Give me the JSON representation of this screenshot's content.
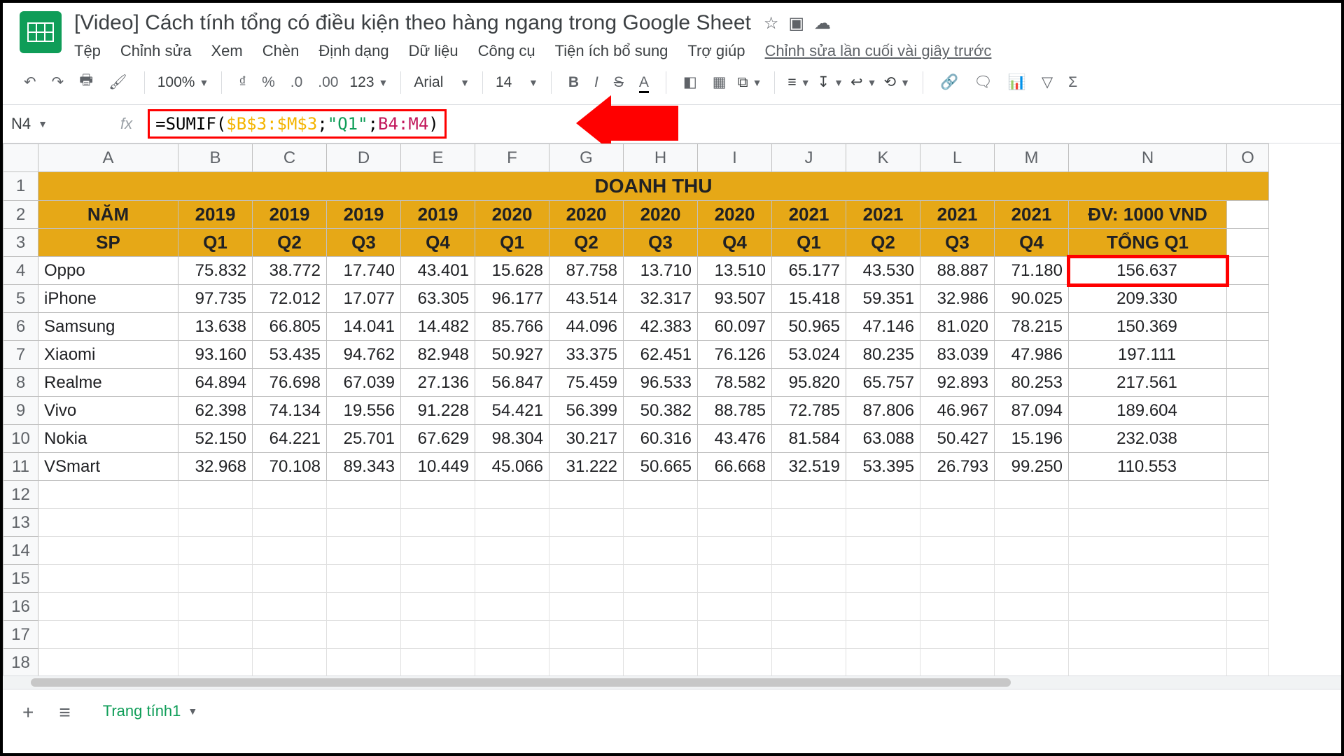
{
  "doc": {
    "title": "[Video] Cách tính tổng có điều kiện theo hàng ngang trong Google Sheet",
    "last_edit": "Chỉnh sửa lần cuối vài giây trước"
  },
  "menu": {
    "file": "Tệp",
    "edit": "Chỉnh sửa",
    "view": "Xem",
    "insert": "Chèn",
    "format": "Định dạng",
    "data": "Dữ liệu",
    "tools": "Công cụ",
    "addons": "Tiện ích bổ sung",
    "help": "Trợ giúp"
  },
  "toolbar": {
    "zoom": "100%",
    "currency": "₫",
    "percent": "%",
    "dec_dec": ".0",
    "dec_inc": ".00",
    "numfmt": "123",
    "font": "Arial",
    "fontsize": "14"
  },
  "namebox": "N4",
  "formula": {
    "func": "=SUMIF(",
    "r1": "$B$3:$M$3",
    "sep1": ";",
    "str": "\"Q1\"",
    "sep2": ";",
    "r2": "B4:M4",
    "close": ")"
  },
  "chart_data": {
    "type": "table",
    "title": "DOANH THU",
    "unit": "ĐV: 1000 VND",
    "col_year": "NĂM",
    "col_sp": "SP",
    "total_label": "TỔNG Q1",
    "years": [
      "2019",
      "2019",
      "2019",
      "2019",
      "2020",
      "2020",
      "2020",
      "2020",
      "2021",
      "2021",
      "2021",
      "2021"
    ],
    "quarters": [
      "Q1",
      "Q2",
      "Q3",
      "Q4",
      "Q1",
      "Q2",
      "Q3",
      "Q4",
      "Q1",
      "Q2",
      "Q3",
      "Q4"
    ],
    "rows": [
      {
        "sp": "Oppo",
        "v": [
          "75.832",
          "38.772",
          "17.740",
          "43.401",
          "15.628",
          "87.758",
          "13.710",
          "13.510",
          "65.177",
          "43.530",
          "88.887",
          "71.180"
        ],
        "total": "156.637"
      },
      {
        "sp": "iPhone",
        "v": [
          "97.735",
          "72.012",
          "17.077",
          "63.305",
          "96.177",
          "43.514",
          "32.317",
          "93.507",
          "15.418",
          "59.351",
          "32.986",
          "90.025"
        ],
        "total": "209.330"
      },
      {
        "sp": "Samsung",
        "v": [
          "13.638",
          "66.805",
          "14.041",
          "14.482",
          "85.766",
          "44.096",
          "42.383",
          "60.097",
          "50.965",
          "47.146",
          "81.020",
          "78.215"
        ],
        "total": "150.369"
      },
      {
        "sp": "Xiaomi",
        "v": [
          "93.160",
          "53.435",
          "94.762",
          "82.948",
          "50.927",
          "33.375",
          "62.451",
          "76.126",
          "53.024",
          "80.235",
          "83.039",
          "47.986"
        ],
        "total": "197.111"
      },
      {
        "sp": "Realme",
        "v": [
          "64.894",
          "76.698",
          "67.039",
          "27.136",
          "56.847",
          "75.459",
          "96.533",
          "78.582",
          "95.820",
          "65.757",
          "92.893",
          "80.253"
        ],
        "total": "217.561"
      },
      {
        "sp": "Vivo",
        "v": [
          "62.398",
          "74.134",
          "19.556",
          "91.228",
          "54.421",
          "56.399",
          "50.382",
          "88.785",
          "72.785",
          "87.806",
          "46.967",
          "87.094"
        ],
        "total": "189.604"
      },
      {
        "sp": "Nokia",
        "v": [
          "52.150",
          "64.221",
          "25.701",
          "67.629",
          "98.304",
          "30.217",
          "60.316",
          "43.476",
          "81.584",
          "63.088",
          "50.427",
          "15.196"
        ],
        "total": "232.038"
      },
      {
        "sp": "VSmart",
        "v": [
          "32.968",
          "70.108",
          "89.343",
          "10.449",
          "45.066",
          "31.222",
          "50.665",
          "66.668",
          "32.519",
          "53.395",
          "26.793",
          "99.250"
        ],
        "total": "110.553"
      }
    ]
  },
  "columns": [
    "A",
    "B",
    "C",
    "D",
    "E",
    "F",
    "G",
    "H",
    "I",
    "J",
    "K",
    "L",
    "M",
    "N",
    "O"
  ],
  "sheet_tab": "Trang tính1"
}
